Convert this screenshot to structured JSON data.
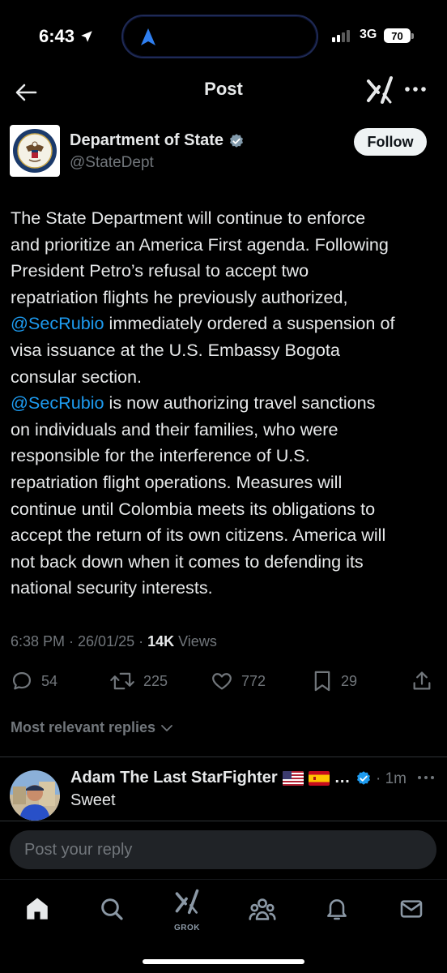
{
  "status_bar": {
    "time": "6:43",
    "network": "3G",
    "battery": "70"
  },
  "header": {
    "title": "Post"
  },
  "author": {
    "name": "Department of State",
    "handle": "@StateDept",
    "follow_label": "Follow"
  },
  "post": {
    "lines": [
      "The State Department will continue to enforce",
      "and prioritize an America First agenda. Following",
      "President Petro’s refusal to accept two",
      "repatriation flights he previously authorized,",
      {
        "mention": "@SecRubio",
        "text": " immediately ordered a suspension of"
      },
      "visa issuance at the U.S. Embassy Bogota",
      "consular section.",
      {
        "mention": "@SecRubio",
        "text": " is now authorizing travel sanctions"
      },
      "on individuals and their families, who were",
      "responsible for the interference of U.S.",
      "repatriation flight operations. Measures will",
      "continue until Colombia meets its obligations to",
      "accept the return of its own citizens. America will",
      "not back down when it comes to defending its",
      "national security interests."
    ],
    "timestamp": "6:38 PM · 26/01/25 · ",
    "views_count": "14K",
    "views_label": " Views"
  },
  "actions": {
    "replies": "54",
    "reposts": "225",
    "likes": "772",
    "bookmarks": "29"
  },
  "sort_label": "Most relevant replies",
  "reply": {
    "name": "Adam The Last StarFighter",
    "ellipsis": "…",
    "time": "· 1m",
    "text": "Sweet"
  },
  "reply_box": {
    "placeholder": "Post your reply"
  },
  "tabbar": {
    "grok_label": "GROK"
  },
  "colors": {
    "background": "#000000",
    "accent": "#1d9bf0",
    "secondary_text": "#71767b"
  }
}
